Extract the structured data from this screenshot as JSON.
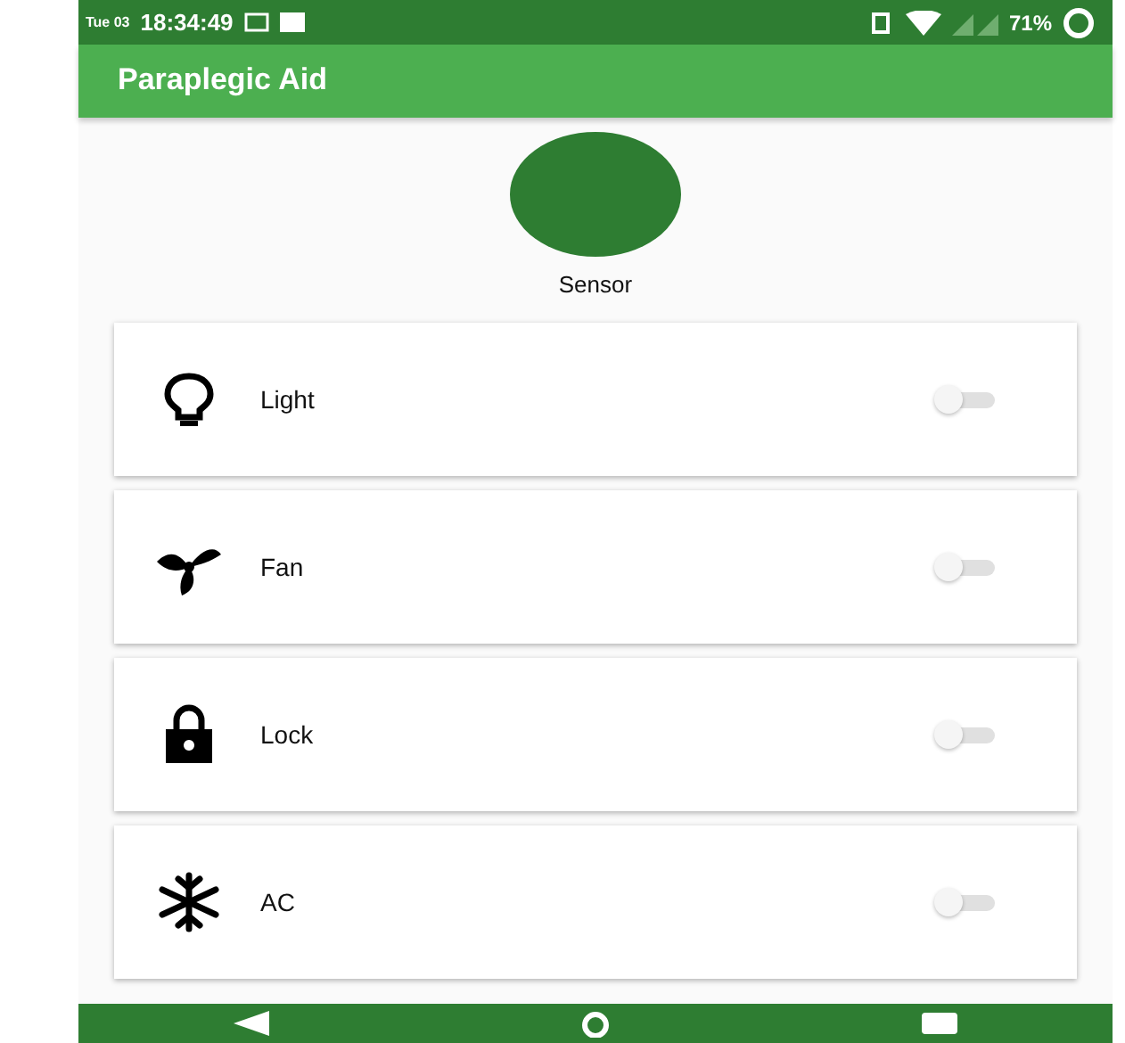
{
  "status_bar": {
    "date": "Tue 03",
    "time": "18:34:49",
    "battery": "71%"
  },
  "app_bar": {
    "title": "Paraplegic Aid"
  },
  "sensor": {
    "label": "Sensor"
  },
  "devices": [
    {
      "kind": "bulb",
      "label": "Light",
      "on": false
    },
    {
      "kind": "fan",
      "label": "Fan",
      "on": false
    },
    {
      "kind": "lock",
      "label": "Lock",
      "on": false
    },
    {
      "kind": "snowflake",
      "label": "AC",
      "on": false
    }
  ]
}
